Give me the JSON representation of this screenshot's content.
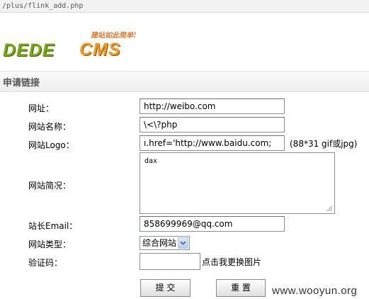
{
  "browser": {
    "url": "/plus/flink_add.php"
  },
  "logo": {
    "slogan": "建站如此简单!",
    "part1": "DEDE",
    "part2": "CMS"
  },
  "section": {
    "title": "申请链接"
  },
  "form": {
    "url_label": "网址：",
    "url_value": "http://weibo.com",
    "site_name_label": "网站名称：",
    "site_name_value": "\\<\\?php",
    "logo_label": "网站Logo：",
    "logo_value": "ı.href='http://www.baidu.com;",
    "logo_hint": "(88*31 gif或jpg)",
    "description_label": "网站简况：",
    "description_value": "dax",
    "email_label": "站长Email：",
    "email_value": "858699969@qq.com",
    "type_label": "网站类型：",
    "type_selected": "综合网站",
    "captcha_label": "验证码：",
    "captcha_value": "",
    "captcha_refresh": "点击我更换图片",
    "submit_label": "提 交",
    "reset_label": "重 置"
  },
  "watermark": "www.wooyun.org"
}
